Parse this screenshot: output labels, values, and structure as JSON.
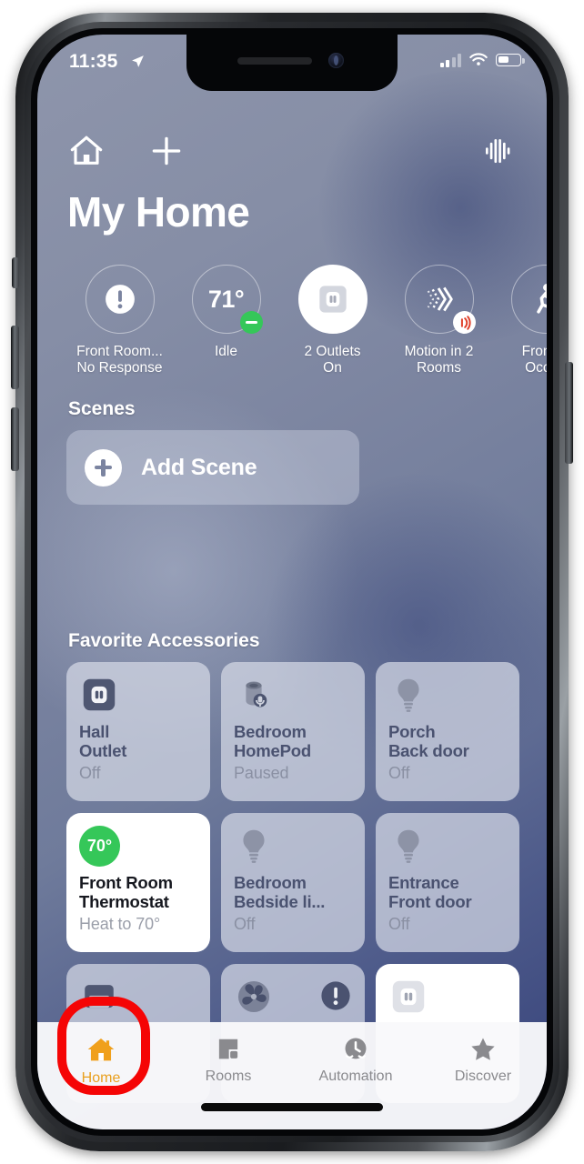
{
  "status_bar": {
    "time": "11:35",
    "location_icon": "location-arrow-icon",
    "cellular_icon": "cellular-bars-icon",
    "wifi_icon": "wifi-icon",
    "battery_icon": "battery-icon"
  },
  "header": {
    "home_icon": "house-icon",
    "add_icon": "plus-icon",
    "speaker_icon": "audio-waveform-icon",
    "title": "My Home"
  },
  "status_circles": [
    {
      "label": "Front Room...\nNo Response",
      "icon": "exclamation-icon",
      "value": "",
      "filled": false,
      "badge": "none"
    },
    {
      "label": "Idle",
      "icon": "temperature-icon",
      "value": "71°",
      "filled": false,
      "badge": "green-minus"
    },
    {
      "label": "2 Outlets\nOn",
      "icon": "outlet-icon",
      "value": "",
      "filled": true,
      "badge": "none"
    },
    {
      "label": "Motion in 2\nRooms",
      "icon": "motion-sensor-icon",
      "value": "",
      "filled": false,
      "badge": "red-motion"
    },
    {
      "label": "Front R\nOccup",
      "icon": "walking-person-icon",
      "value": "",
      "filled": false,
      "badge": "none"
    }
  ],
  "scenes": {
    "section_title": "Scenes",
    "add_scene_label": "Add Scene",
    "add_scene_icon": "plus-circle-icon"
  },
  "favorites": {
    "section_title": "Favorite Accessories",
    "tiles": [
      {
        "icon": "outlet-icon",
        "name": "Hall\nOutlet",
        "state": "Off",
        "active": false,
        "temp": ""
      },
      {
        "icon": "homepod-icon",
        "name": "Bedroom\nHomePod",
        "state": "Paused",
        "active": false,
        "temp": ""
      },
      {
        "icon": "lightbulb-icon",
        "name": "Porch\nBack door",
        "state": "Off",
        "active": false,
        "temp": ""
      },
      {
        "icon": "thermostat-icon",
        "name": "Front Room\nThermostat",
        "state": "Heat to 70°",
        "active": true,
        "temp": "70°"
      },
      {
        "icon": "lightbulb-icon",
        "name": "Bedroom\nBedside li...",
        "state": "Off",
        "active": false,
        "temp": ""
      },
      {
        "icon": "lightbulb-icon",
        "name": "Entrance\nFront door",
        "state": "Off",
        "active": false,
        "temp": ""
      }
    ],
    "partial_row": [
      {
        "icon": "garage-door-icon",
        "active": false
      },
      {
        "icon": "fan-icon",
        "active": false,
        "badge": "alert"
      },
      {
        "icon": "outlet-icon",
        "active": true
      }
    ]
  },
  "tab_bar": [
    {
      "label": "Home",
      "icon": "house-icon",
      "active": true
    },
    {
      "label": "Rooms",
      "icon": "rooms-icon",
      "active": false
    },
    {
      "label": "Automation",
      "icon": "clock-check-icon",
      "active": false
    },
    {
      "label": "Discover",
      "icon": "star-icon",
      "active": false
    }
  ],
  "annotation": {
    "shape": "red-rounded-rect-highlight",
    "target": "Home",
    "color": "#f50505"
  }
}
